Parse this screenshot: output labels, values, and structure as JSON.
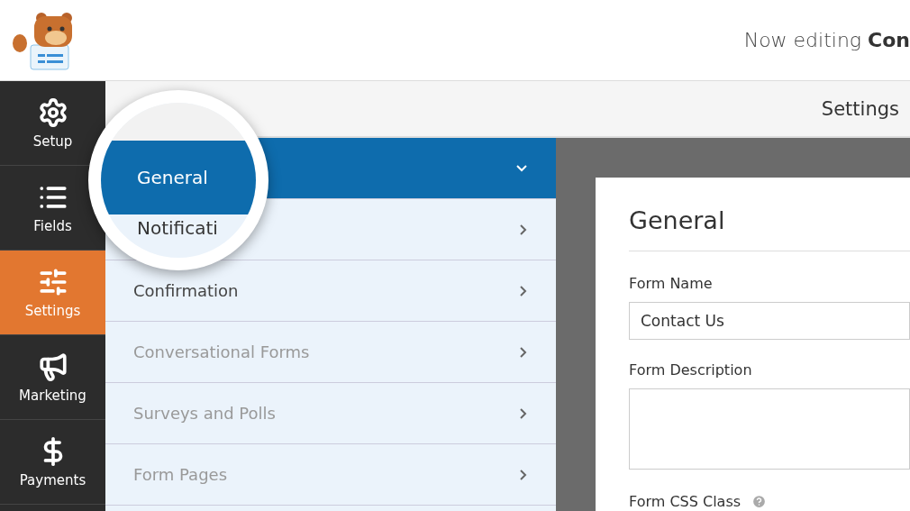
{
  "header": {
    "title": "Now editing **Con**"
  },
  "sidebar": {
    "items": [
      {
        "label": "Setup",
        "selected": false
      },
      {
        "label": "Fields",
        "selected": false
      },
      {
        "label": "Settings",
        "selected": true
      },
      {
        "label": "Marketing",
        "selected": false
      },
      {
        "label": "Payments",
        "selected": false
      }
    ]
  },
  "topbar": {
    "title": "Settings"
  },
  "sections": [
    {
      "selected": true,
      "expanded": true
    },
    {
      "selected": false,
      "expanded": false
    },
    {
      "label": "Confirmation",
      "selected": false,
      "expanded": false
    },
    {
      "label": "Conversational Forms",
      "selected": false,
      "expanded": false
    },
    {
      "label": "Surveys and Polls",
      "selected": false,
      "expanded": false
    },
    {
      "label": "Form Pages",
      "selected": false,
      "expanded": false
    }
  ],
  "magnifier": {
    "items": [
      "General",
      "Notificati"
    ]
  },
  "panel": {
    "title": "General",
    "fields": [
      {
        "kind": "input",
        "label": "Form Name",
        "value": "Contact Us"
      },
      {
        "kind": "textarea",
        "label": "Form Description"
      },
      {
        "kind": "label",
        "label": "Form CSS Class"
      }
    ]
  }
}
